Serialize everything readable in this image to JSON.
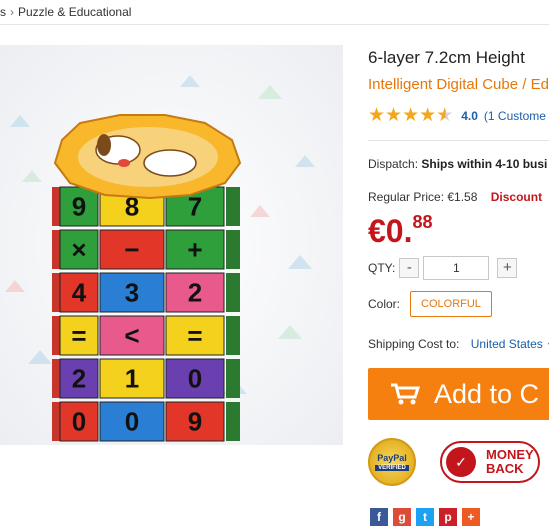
{
  "breadcrumb": {
    "prev": "s",
    "sep": "›",
    "current": "Puzzle & Educational"
  },
  "product": {
    "title": "6-layer 7.2cm Height",
    "subtitle": "Intelligent Digital Cube / Ed",
    "rating": {
      "value": "4.0",
      "reviews": "(1 Custome",
      "stars": 4
    },
    "dispatch_label": "Dispatch:",
    "dispatch_value": "Ships within 4-10 busi",
    "regular_label": "Regular Price:",
    "regular_value": "€1.58",
    "discount_label": "Discount",
    "price_main": "€0.",
    "price_cents": "88",
    "qty_label": "QTY:",
    "qty_minus": "-",
    "qty_value": "1",
    "qty_plus": "+",
    "color_label": "Color:",
    "color_value": "COLORFUL",
    "shipping_label": "Shipping Cost to:",
    "shipping_country": "United States",
    "add_to_cart": "Add to C",
    "paypal_text": "PayPal",
    "paypal_verified": "VERIFIED",
    "moneyback_line1": "MONEY",
    "moneyback_line2": "BACK"
  },
  "cube_rows": [
    {
      "cells": [
        "9",
        "8",
        "7"
      ],
      "colors": [
        "#2e9f3a",
        "#f4d11c",
        "#2e9f3a"
      ]
    },
    {
      "cells": [
        "×",
        "−",
        "+"
      ],
      "colors": [
        "#2e9f3a",
        "#e23628",
        "#2e9f3a"
      ]
    },
    {
      "cells": [
        "4",
        "3",
        "2"
      ],
      "colors": [
        "#e23628",
        "#2a7fd4",
        "#e85a8c"
      ]
    },
    {
      "cells": [
        "=",
        "<",
        "="
      ],
      "colors": [
        "#f4d11c",
        "#e85a8c",
        "#f4d11c"
      ]
    },
    {
      "cells": [
        "2",
        "1",
        "0"
      ],
      "colors": [
        "#6a3fb0",
        "#f4d11c",
        "#6a3fb0"
      ]
    },
    {
      "cells": [
        "0",
        "0",
        "9"
      ],
      "colors": [
        "#e23628",
        "#2a7fd4",
        "#e23628"
      ]
    }
  ],
  "colors": {
    "accent_orange": "#f57f0f",
    "price_red": "#c3161c",
    "link_blue": "#1a5fa8"
  },
  "icons": [
    "cart-icon",
    "paypal-badge-icon",
    "money-back-badge-icon",
    "facebook-icon",
    "google-plus-icon",
    "twitter-icon",
    "pinterest-icon",
    "share-plus-icon"
  ]
}
